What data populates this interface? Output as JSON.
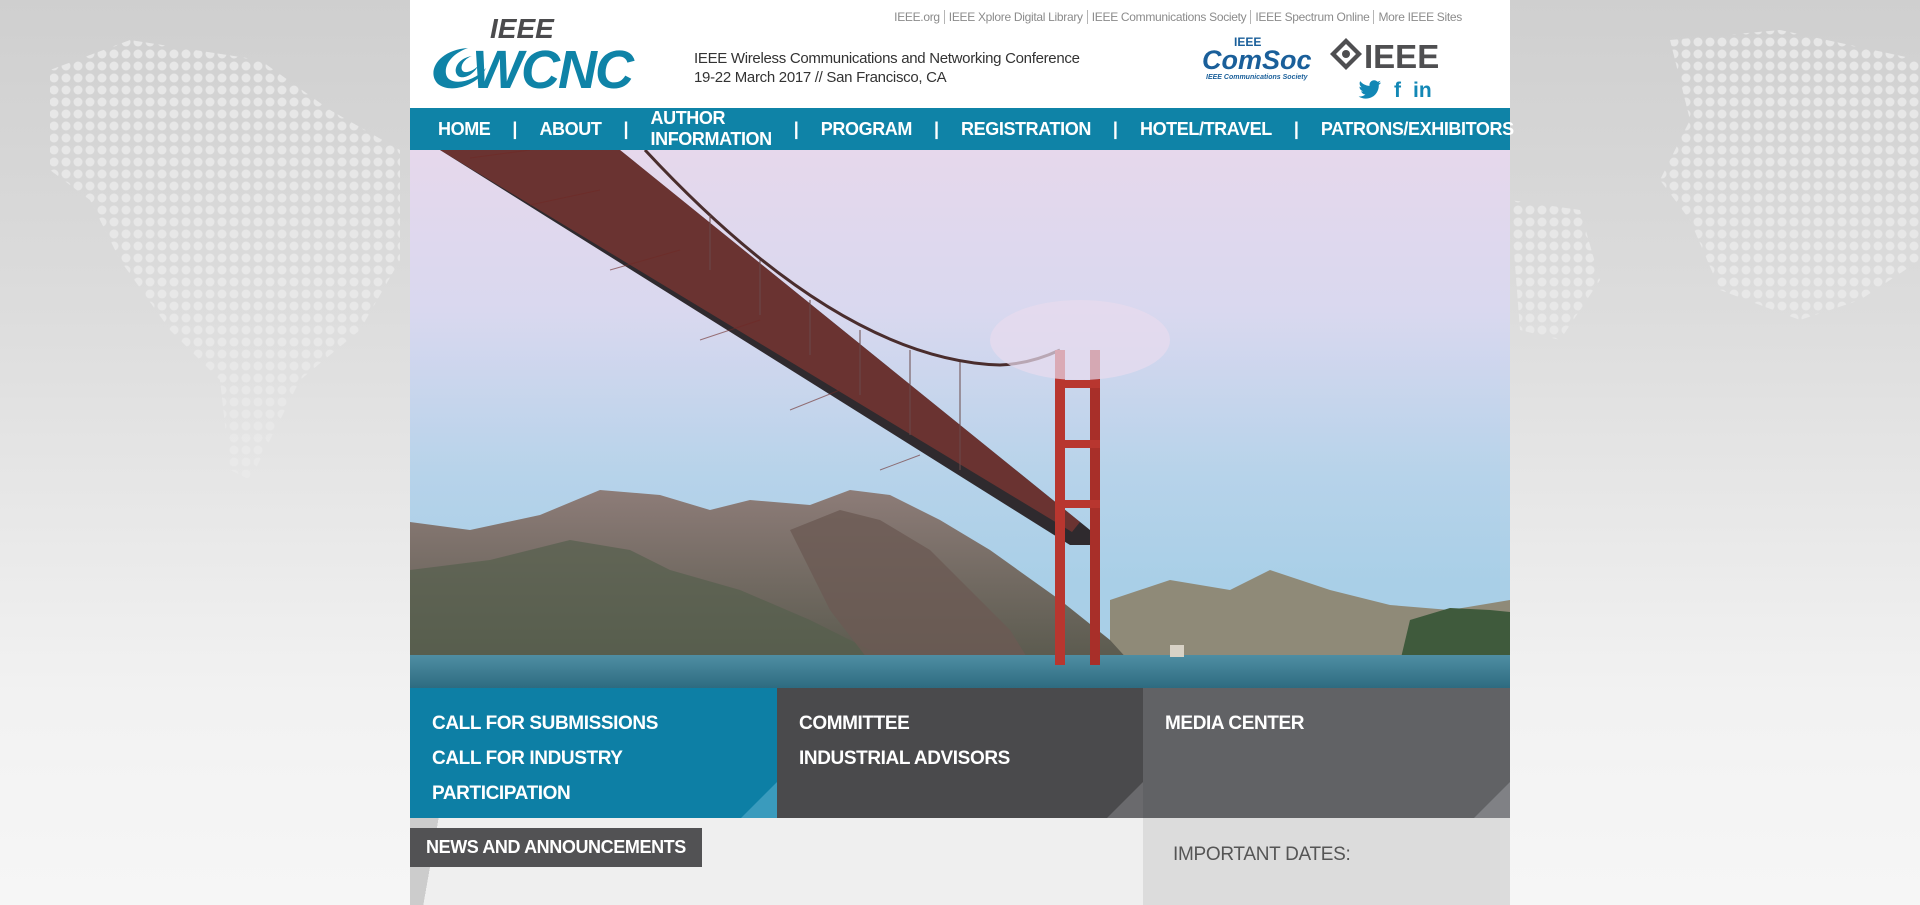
{
  "utility_links": [
    "IEEE.org",
    "IEEE Xplore Digital Library",
    "IEEE Communications Society",
    "IEEE Spectrum Online",
    "More IEEE Sites"
  ],
  "logo": {
    "ieee": "IEEE",
    "wcnc": "WCNC"
  },
  "conference": {
    "name": "IEEE Wireless Communications and Networking Conference",
    "dates_location": "19-22 March 2017 // San Francisco, CA"
  },
  "partner_logos": {
    "comsoc_top": "IEEE",
    "comsoc_name": "ComSoc",
    "comsoc_sub": "IEEE Communications Society",
    "ieee": "IEEE"
  },
  "social": {
    "twitter": "🐦",
    "facebook": "f",
    "linkedin": "in"
  },
  "nav": {
    "items": [
      "HOME",
      "ABOUT",
      "AUTHOR INFORMATION",
      "PROGRAM",
      "REGISTRATION",
      "HOTEL/TRAVEL",
      "PATRONS/EXHIBITORS"
    ],
    "separator": "|"
  },
  "hero": {
    "slides": 6,
    "active_slide": 1
  },
  "tiles": [
    {
      "links": [
        "CALL FOR SUBMISSIONS",
        "CALL FOR INDUSTRY PARTICIPATION"
      ]
    },
    {
      "links": [
        "COMMITTEE",
        "INDUSTRIAL ADVISORS"
      ]
    },
    {
      "links": [
        "MEDIA CENTER"
      ]
    }
  ],
  "news": {
    "title": "NEWS AND ANNOUNCEMENTS"
  },
  "dates": {
    "title": "IMPORTANT DATES:"
  },
  "colors": {
    "primary": "#0f83a7",
    "dark_gray": "#4a4a4c",
    "mid_gray": "#616265"
  }
}
